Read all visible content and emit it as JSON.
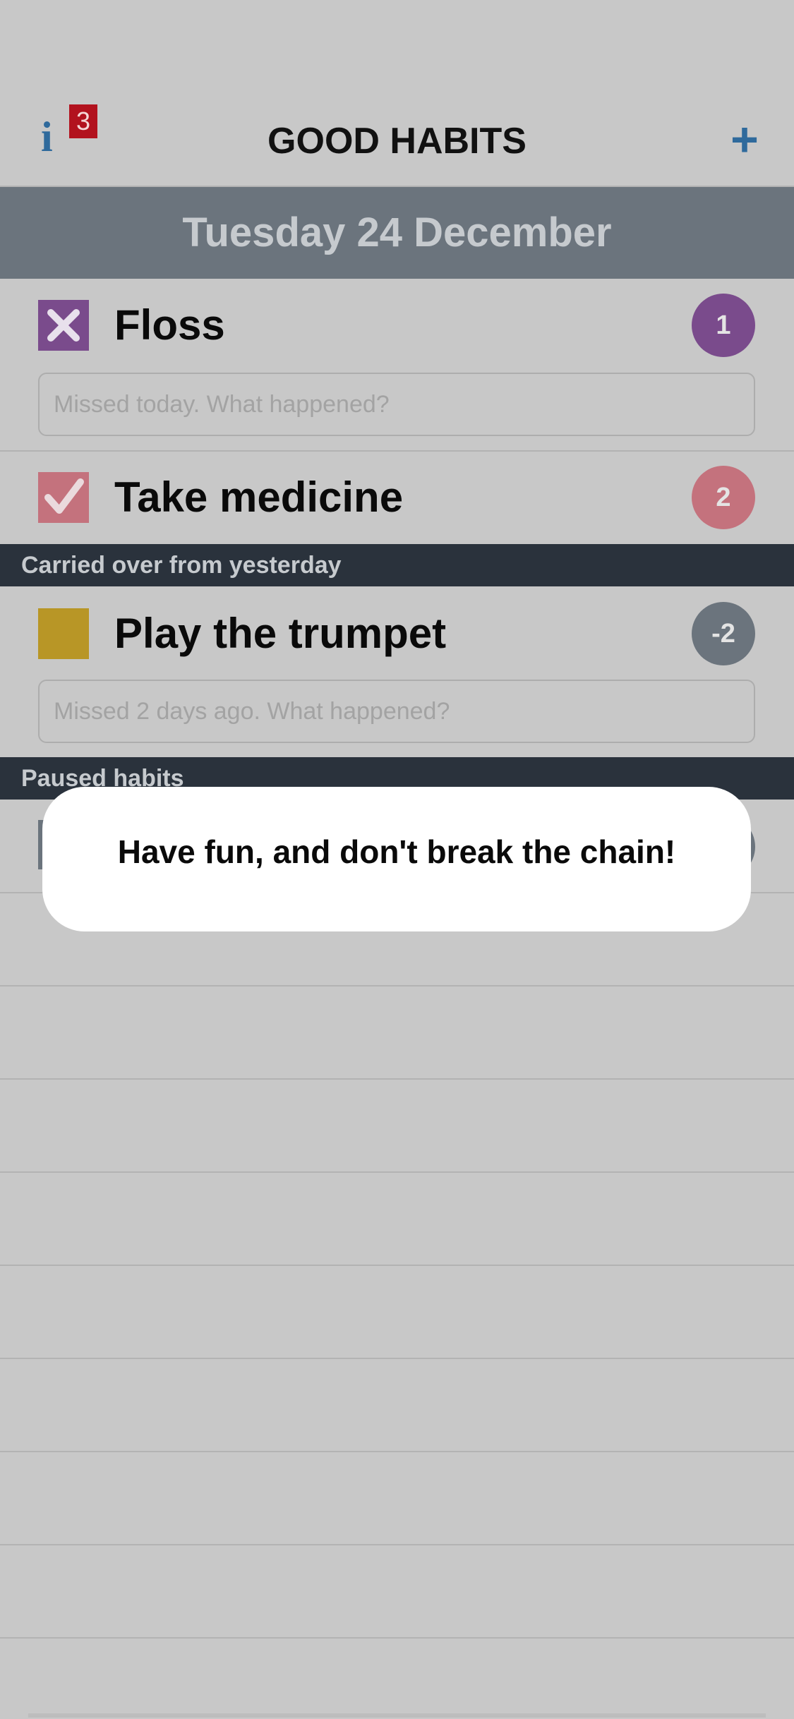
{
  "nav": {
    "title": "GOOD HABITS",
    "info_glyph": "i",
    "info_badge_count": "3",
    "add_glyph": "+",
    "info_icon": "info-icon",
    "add_icon": "plus-icon"
  },
  "date_header": "Tuesday 24 December",
  "habits_today": [
    {
      "label": "Floss",
      "status": "missed",
      "checkbox_icon": "x-icon",
      "color": "#7a4b8c",
      "count": "1",
      "note_placeholder": "Missed today. What happened?"
    },
    {
      "label": "Take medicine",
      "status": "done",
      "checkbox_icon": "check-icon",
      "color": "#c4727d",
      "count": "2"
    }
  ],
  "carried_over": {
    "header": "Carried over from yesterday",
    "habits": [
      {
        "label": "Play the trumpet",
        "status": "pending",
        "color": "#b89626",
        "count": "-2",
        "count_color": "#6b747d",
        "note_placeholder": "Missed 2 days ago. What happened?"
      }
    ]
  },
  "paused": {
    "header": "Paused habits"
  },
  "toast": {
    "message": "Have fun, and don't break the chain!"
  },
  "colors": {
    "background": "#c8c8c8",
    "accent": "#2f6a9c",
    "badge_red": "#b2121e",
    "date_header_bg": "#6b747d",
    "section_header_bg": "#2a323c"
  }
}
